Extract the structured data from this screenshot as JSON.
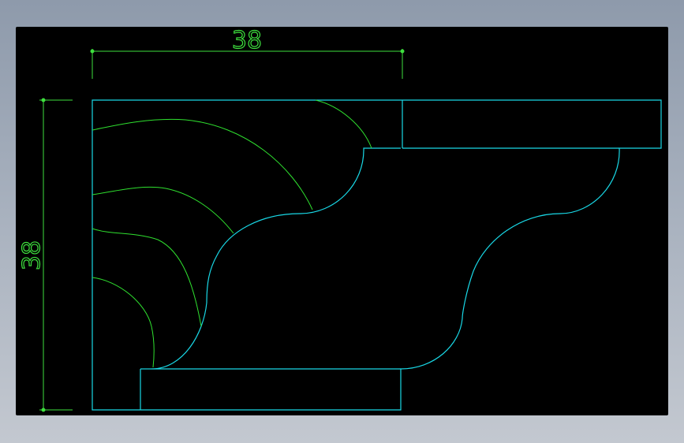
{
  "drawing": {
    "dimensions": {
      "horizontal_value": "38",
      "vertical_value": "38"
    },
    "colors": {
      "background": "#000000",
      "outline": "#19d8e6",
      "hatch": "#2fe02f",
      "dimension": "#3ee03e"
    }
  }
}
